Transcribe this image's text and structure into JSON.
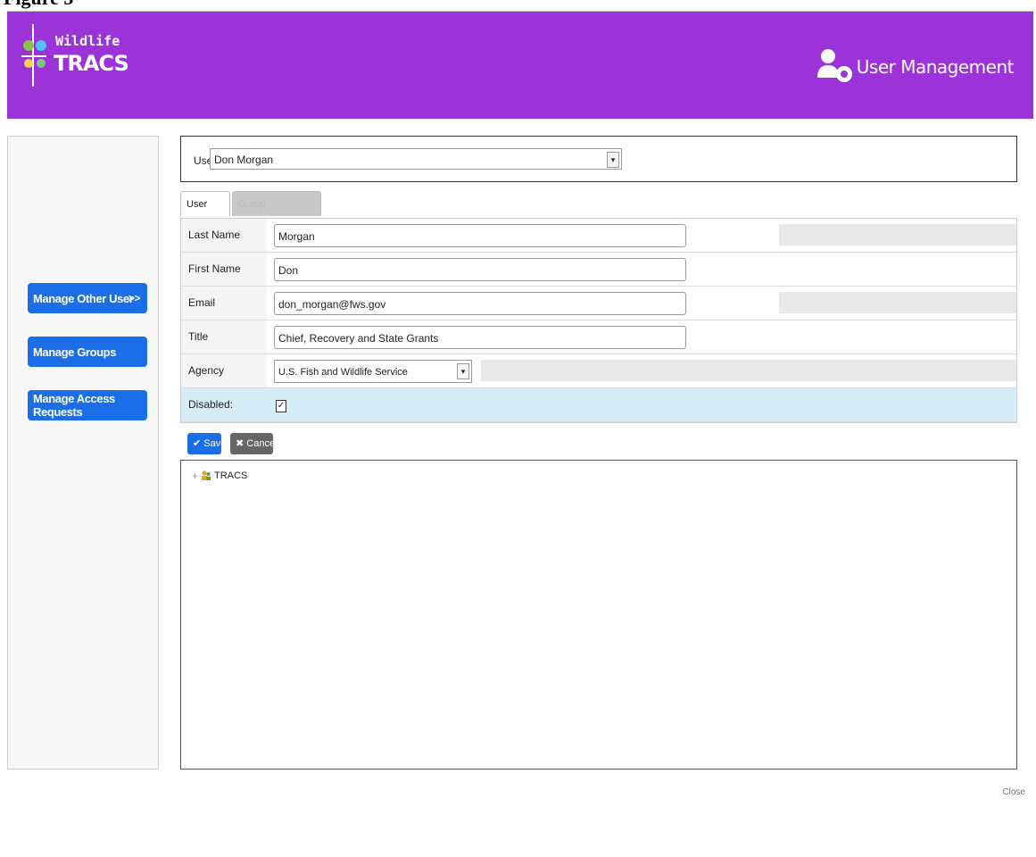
{
  "figure_caption": "Figure 5",
  "header": {
    "logo_line1": "Wildlife",
    "logo_line2": "TRACS",
    "title": "User Management",
    "bg_color": "#9b33d9"
  },
  "sidebar": {
    "items": [
      {
        "label": "Manage Other User",
        "chevron": ">>"
      },
      {
        "label": "Manage Groups"
      },
      {
        "label": "Manage Access Requests"
      }
    ],
    "button_color": "#1a6fe8"
  },
  "user_select": {
    "label": "User:",
    "value": "Don Morgan"
  },
  "tabs": [
    {
      "label": "User Profile"
    },
    {
      "label": "Group Permissions"
    }
  ],
  "form": {
    "last_name": {
      "label": "Last Name",
      "value": "Morgan"
    },
    "first_name": {
      "label": "First Name",
      "value": "Don"
    },
    "email": {
      "label": "Email",
      "value": "don_morgan@fws.gov"
    },
    "title": {
      "label": "Title",
      "value": "Chief, Recovery and State Grants"
    },
    "agency": {
      "label": "Agency",
      "value": "U.S. Fish and Wildlife Service"
    },
    "disabled": {
      "label": "Disabled:",
      "checked": true
    }
  },
  "actions": {
    "save": "Save",
    "cancel": "Cancel"
  },
  "tree": {
    "root_label": "TRACS"
  },
  "footer": {
    "close": "Close"
  }
}
